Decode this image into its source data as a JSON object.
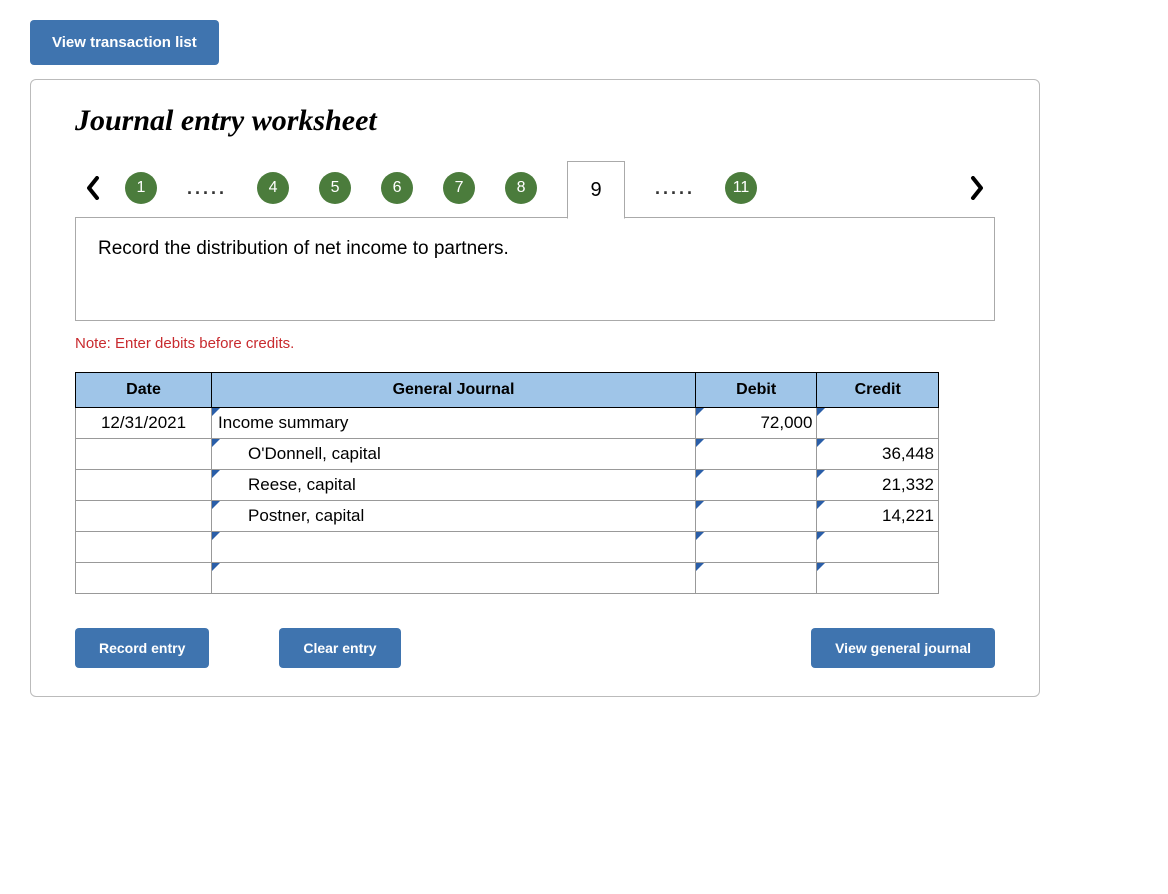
{
  "top_button": "View transaction list",
  "worksheet_title": "Journal entry worksheet",
  "tabs": {
    "visible": [
      "1",
      "…",
      "4",
      "5",
      "6",
      "7",
      "8",
      "9",
      "…",
      "11"
    ],
    "items": {
      "t1": "1",
      "t4": "4",
      "t5": "5",
      "t6": "6",
      "t7": "7",
      "t8": "8",
      "t9": "9",
      "t11": "11"
    },
    "ellipsis": "....."
  },
  "instruction": "Record the distribution of net income to partners.",
  "note": "Note: Enter debits before credits.",
  "headers": {
    "date": "Date",
    "gj": "General Journal",
    "debit": "Debit",
    "credit": "Credit"
  },
  "rows": [
    {
      "date": "12/31/2021",
      "account": "Income summary",
      "indent": false,
      "debit": "72,000",
      "credit": ""
    },
    {
      "date": "",
      "account": "O'Donnell, capital",
      "indent": true,
      "debit": "",
      "credit": "36,448"
    },
    {
      "date": "",
      "account": "Reese, capital",
      "indent": true,
      "debit": "",
      "credit": "21,332"
    },
    {
      "date": "",
      "account": "Postner, capital",
      "indent": true,
      "debit": "",
      "credit": "14,221"
    },
    {
      "date": "",
      "account": "",
      "indent": false,
      "debit": "",
      "credit": ""
    },
    {
      "date": "",
      "account": "",
      "indent": false,
      "debit": "",
      "credit": ""
    }
  ],
  "buttons": {
    "record": "Record entry",
    "clear": "Clear entry",
    "view_gj": "View general journal"
  }
}
